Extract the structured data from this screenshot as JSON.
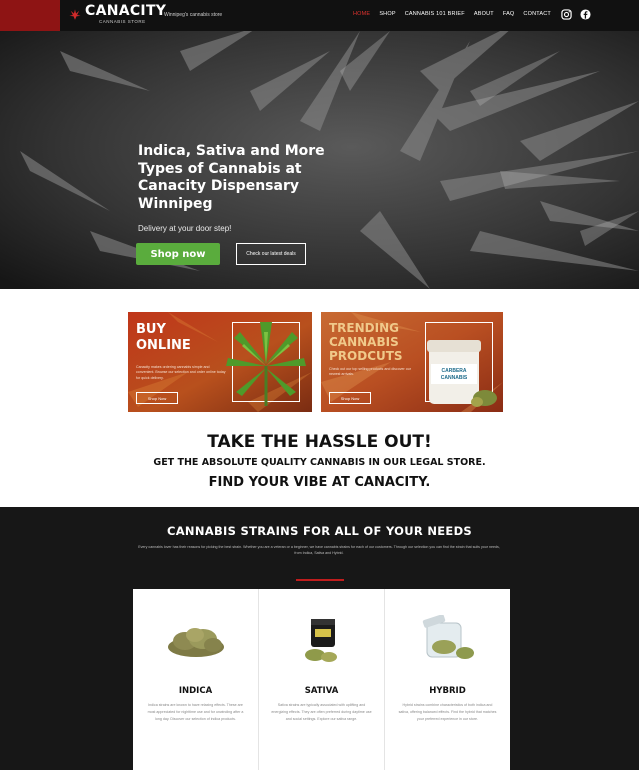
{
  "header": {
    "logo_name": "CANACITY",
    "logo_sub": "CANNABIS STORE",
    "tagline": "Winnipeg's cannabis store",
    "nav": [
      "HOME",
      "SHOP",
      "CANNABIS 101 BRIEF",
      "ABOUT",
      "FAQ",
      "CONTACT"
    ],
    "active_nav": "HOME",
    "social_icons": [
      "instagram-icon",
      "facebook-icon"
    ],
    "brand_color": "#8e1414"
  },
  "hero": {
    "title": "Indica, Sativa and More Types of Cannabis at Canacity Dispensary Winnipeg",
    "subtitle": "Delivery at your door step!",
    "primary_button": "Shop now",
    "secondary_button": "Check our latest deals",
    "primary_color": "#5aac3d"
  },
  "promos": {
    "buy": {
      "title_line1": "BUY",
      "title_line2": "ONLINE",
      "text": "Canacity makes ordering cannabis simple and convenient. Browse our selection and order online today for quick delivery.",
      "button": "Shop Now"
    },
    "trending": {
      "title_line1": "TRENDING",
      "title_line2": "CANNABIS",
      "title_line3": "PRODCUTS",
      "text": "Check out our top selling products and discover our newest arrivals.",
      "button": "Shop Now",
      "jar_label": "CARBERA CANNABIS"
    }
  },
  "hassle": {
    "heading": "TAKE THE HASSLE OUT!",
    "subheading": "GET THE ABSOLUTE QUALITY CANNABIS IN OUR LEGAL STORE.",
    "tagline": "FIND YOUR VIBE AT CANACITY."
  },
  "strains": {
    "title": "CANNABIS STRAINS FOR ALL OF YOUR NEEDS",
    "description": "Every cannabis lover has their reasons for picking the best strain. Whether you are a veteran or a beginner, we have cannabis strains for each of our customers. Through our selection you can find the strain that suits your needs, from Indica, Sativa and Hybrid.",
    "accent_color": "#c01d1d",
    "cards": [
      {
        "name": "INDICA",
        "text": "Indica strains are known to have relaxing effects. These are most appreciated for nighttime use and for unwinding after a long day. Discover our selection of indica products."
      },
      {
        "name": "SATIVA",
        "text": "Sativa strains are typically associated with uplifting and energizing effects. They are often preferred during daytime use and social settings. Explore our sativa range."
      },
      {
        "name": "HYBRID",
        "text": "Hybrid strains combine characteristics of both indica and sativa, offering balanced effects. Find the hybrid that matches your preferred experience in our store."
      }
    ]
  }
}
